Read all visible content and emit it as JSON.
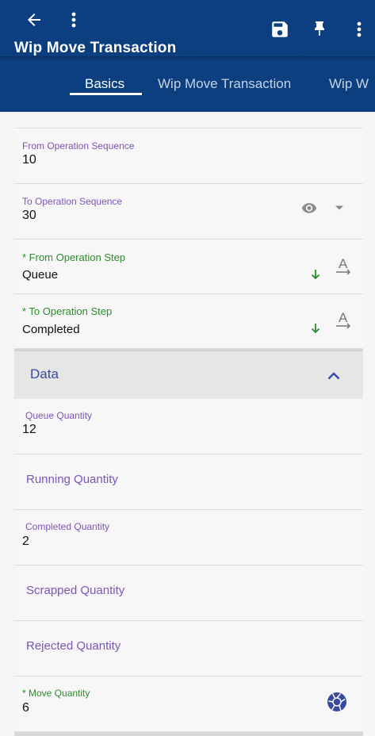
{
  "header": {
    "title": "Wip Move Transaction",
    "icons": [
      "arrow-back-icon",
      "more-vert-icon",
      "save-icon",
      "pin-icon",
      "more-vert-icon"
    ]
  },
  "tabs": [
    {
      "label": "Basics",
      "active": true
    },
    {
      "label": "Wip Move Transaction",
      "active": false
    },
    {
      "label": "Wip W",
      "active": false
    }
  ],
  "fields": {
    "from_seq": {
      "label": "From Operation Sequence",
      "value": "10"
    },
    "to_seq": {
      "label": "To Operation Sequence",
      "value": "30"
    },
    "from_step": {
      "label": "* From Operation Step",
      "value": "Queue"
    },
    "to_step": {
      "label": "* To Operation Step",
      "value": "Completed"
    }
  },
  "data_section": {
    "title": "Data",
    "queue_qty": {
      "label": "Queue Quantity",
      "value": "12"
    },
    "running_qty": {
      "label": "Running Quantity"
    },
    "completed_qty": {
      "label": "Completed Quantity",
      "value": "2"
    },
    "scrapped_qty": {
      "label": "Scrapped Quantity"
    },
    "rejected_qty": {
      "label": "Rejected Quantity"
    },
    "move_qty": {
      "label": "* Move Quantity",
      "value": "6"
    }
  },
  "colors": {
    "header_bg": "#0b3f80",
    "label_purple": "#7d55b5",
    "label_green": "#2d8a2d",
    "section_title": "#3a4aa0"
  }
}
